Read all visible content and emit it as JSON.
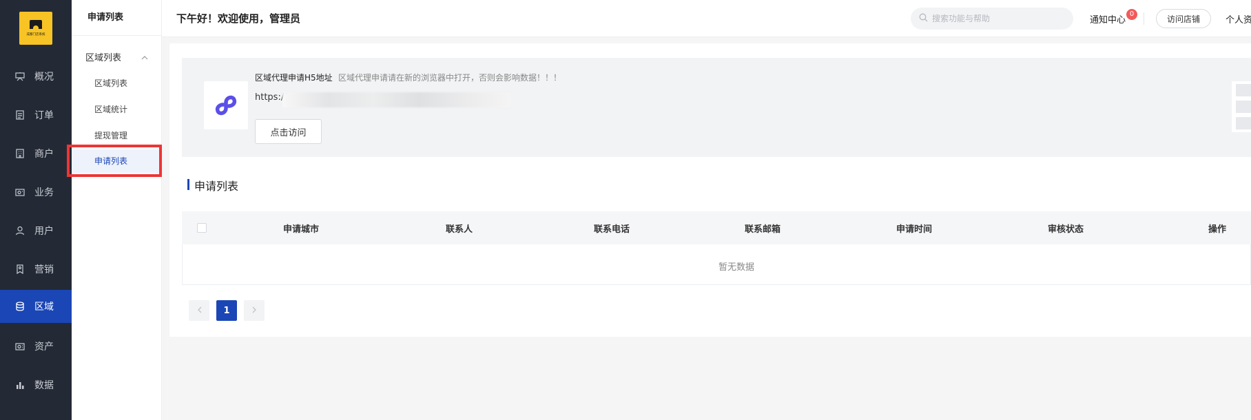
{
  "logo": {
    "text": "成都门店系统"
  },
  "nav": {
    "items": [
      {
        "label": "概况",
        "icon": "presentation-icon"
      },
      {
        "label": "订单",
        "icon": "document-icon"
      },
      {
        "label": "商户",
        "icon": "building-icon"
      },
      {
        "label": "业务",
        "icon": "briefcase-icon"
      },
      {
        "label": "用户",
        "icon": "user-icon"
      },
      {
        "label": "营销",
        "icon": "tag-icon"
      },
      {
        "label": "区域",
        "icon": "database-icon"
      },
      {
        "label": "资产",
        "icon": "money-icon"
      },
      {
        "label": "数据",
        "icon": "bar-chart-icon"
      }
    ],
    "active_index": 6
  },
  "submenu": {
    "title": "申请列表",
    "group_label": "区域列表",
    "items": [
      {
        "label": "区域列表"
      },
      {
        "label": "区域统计"
      },
      {
        "label": "提现管理"
      },
      {
        "label": "申请列表"
      }
    ],
    "active_index": 3
  },
  "header": {
    "greeting": "下午好！欢迎使用，管理员",
    "search_placeholder": "搜索功能与帮助",
    "notify_label": "通知中心",
    "notify_count": "0",
    "visit_store_label": "访问店铺",
    "profile_label": "个人资"
  },
  "banner": {
    "title": "区域代理申请H5地址",
    "tip": "区域代理申请请在新的浏览器中打开，否则会影响数据！！！",
    "url_prefix": "https://",
    "visit_button": "点击访问"
  },
  "table": {
    "section_title": "申请列表",
    "columns": [
      "申请城市",
      "联系人",
      "联系电话",
      "联系邮箱",
      "申请时间",
      "审核状态",
      "操作"
    ],
    "empty_text": "暂无数据"
  },
  "pagination": {
    "current_page": "1"
  },
  "colors": {
    "primary": "#1b46b5",
    "sidebar_bg": "#232a36",
    "highlight_border": "#ee3535",
    "badge": "#f25a5a"
  }
}
